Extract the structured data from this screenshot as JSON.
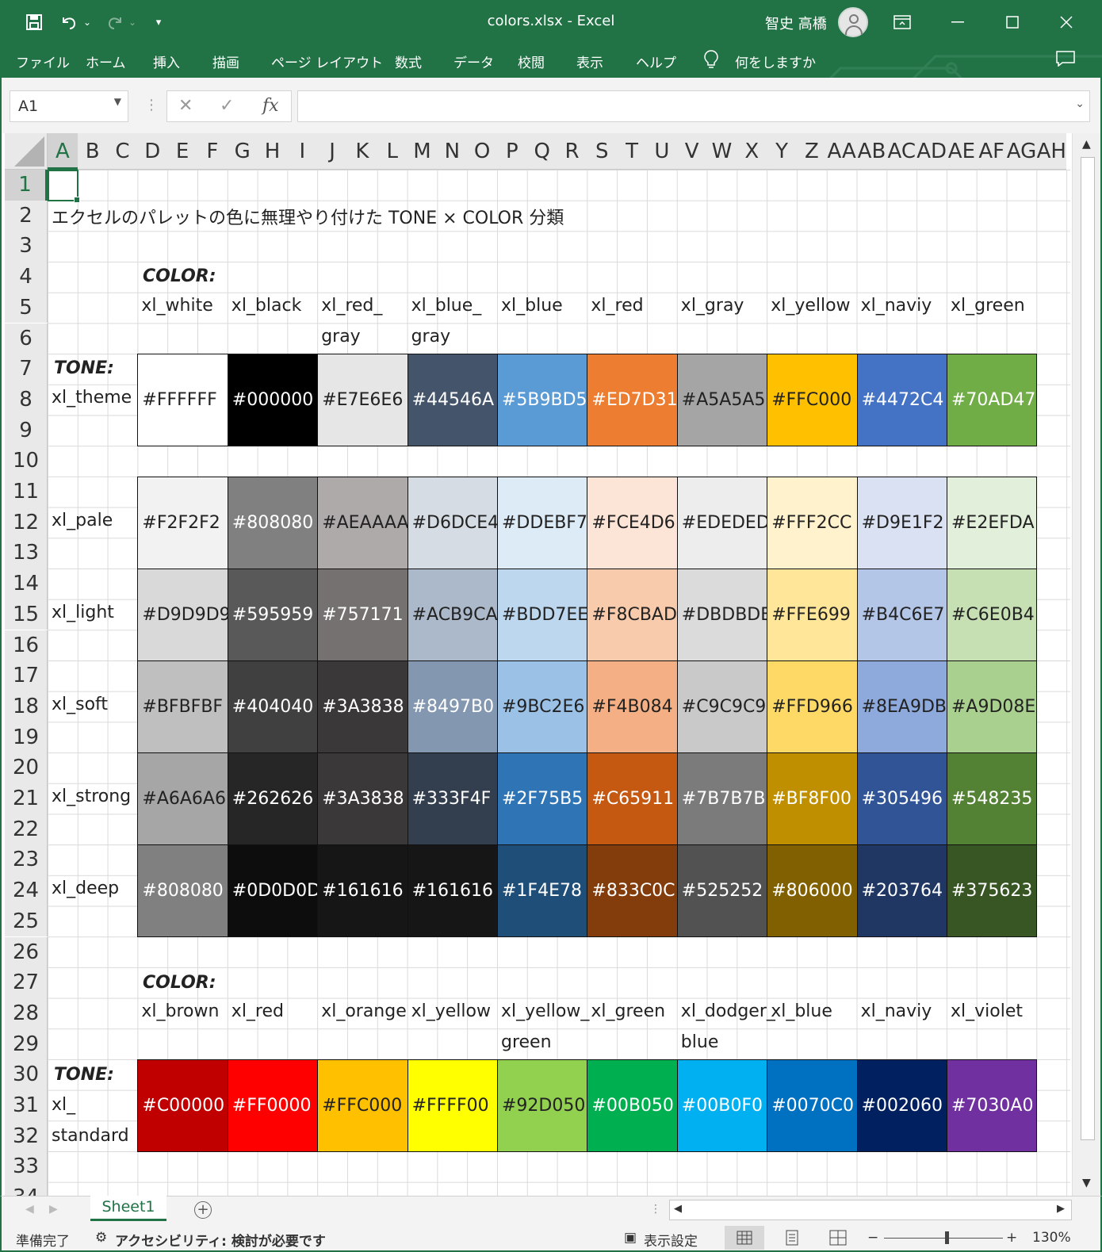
{
  "window": {
    "title": "colors.xlsx  -  Excel",
    "user": "智史 高橋",
    "save_icon": "save-icon",
    "undo_icon": "undo-icon",
    "redo_icon": "redo-icon"
  },
  "ribbon": {
    "tabs": [
      "ファイル",
      "ホーム",
      "挿入",
      "描画",
      "ページ レイアウト",
      "数式",
      "データ",
      "校閲",
      "表示",
      "ヘルプ"
    ],
    "tell_me": "何をしますか"
  },
  "formula_bar": {
    "name_box": "A1",
    "fx_label": "fx",
    "formula": ""
  },
  "columns": [
    "A",
    "B",
    "C",
    "D",
    "E",
    "F",
    "G",
    "H",
    "I",
    "J",
    "K",
    "L",
    "M",
    "N",
    "O",
    "P",
    "Q",
    "R",
    "S",
    "T",
    "U",
    "V",
    "W",
    "X",
    "Y",
    "Z",
    "AA",
    "AB",
    "AC",
    "AD",
    "AE",
    "AF",
    "AG",
    "AH"
  ],
  "rows": [
    "1",
    "2",
    "3",
    "4",
    "5",
    "6",
    "7",
    "8",
    "9",
    "10",
    "11",
    "12",
    "13",
    "14",
    "15",
    "16",
    "17",
    "18",
    "19",
    "20",
    "21",
    "22",
    "23",
    "24",
    "25",
    "26",
    "27",
    "28",
    "29",
    "30",
    "31",
    "32",
    "33",
    "34"
  ],
  "sheet": {
    "heading": "エクセルのパレットの色に無理やり付けた TONE × COLOR 分類",
    "color_label": "COLOR:",
    "tone_label": "TONE:",
    "theme_colors": [
      "xl_white",
      "xl_black",
      "xl_red_",
      "xl_blue_",
      "xl_blue",
      "xl_red",
      "xl_gray",
      "xl_yellow",
      "xl_naviy",
      "xl_green"
    ],
    "theme_colors_line2": [
      "",
      "",
      "gray",
      "gray",
      "",
      "",
      "",
      "",
      "",
      ""
    ],
    "tones": [
      {
        "name": "xl_theme",
        "values": [
          "#FFFFFF",
          "#000000",
          "#E7E6E6",
          "#44546A",
          "#5B9BD5",
          "#ED7D31",
          "#A5A5A5",
          "#FFC000",
          "#4472C4",
          "#70AD47"
        ]
      },
      {
        "name": "xl_pale",
        "values": [
          "#F2F2F2",
          "#808080",
          "#AEAAAA",
          "#D6DCE4",
          "#DDEBF7",
          "#FCE4D6",
          "#EDEDED",
          "#FFF2CC",
          "#D9E1F2",
          "#E2EFDA"
        ]
      },
      {
        "name": "xl_light",
        "values": [
          "#D9D9D9",
          "#595959",
          "#757171",
          "#ACB9CA",
          "#BDD7EE",
          "#F8CBAD",
          "#DBDBDB",
          "#FFE699",
          "#B4C6E7",
          "#C6E0B4"
        ]
      },
      {
        "name": "xl_soft",
        "values": [
          "#BFBFBF",
          "#404040",
          "#3A3838",
          "#8497B0",
          "#9BC2E6",
          "#F4B084",
          "#C9C9C9",
          "#FFD966",
          "#8EA9DB",
          "#A9D08E"
        ]
      },
      {
        "name": "xl_strong",
        "values": [
          "#A6A6A6",
          "#262626",
          "#3A3838",
          "#333F4F",
          "#2F75B5",
          "#C65911",
          "#7B7B7B",
          "#BF8F00",
          "#305496",
          "#548235"
        ]
      },
      {
        "name": "xl_deep",
        "values": [
          "#808080",
          "#0D0D0D",
          "#161616",
          "#161616",
          "#1F4E78",
          "#833C0C",
          "#525252",
          "#806000",
          "#203764",
          "#375623"
        ]
      }
    ],
    "standard_colors": [
      "xl_brown",
      "xl_red",
      "xl_orange",
      "xl_yellow",
      "xl_yellow_",
      "xl_green",
      "xl_dodger_",
      "xl_blue",
      "xl_naviy",
      "xl_violet"
    ],
    "standard_colors_line2": [
      "",
      "",
      "",
      "",
      "green",
      "",
      "blue",
      "",
      "",
      ""
    ],
    "standard_tone_line1": "xl_",
    "standard_tone_line2": "standard",
    "standard_values": [
      "#C00000",
      "#FF0000",
      "#FFC000",
      "#FFFF00",
      "#92D050",
      "#00B050",
      "#00B0F0",
      "#0070C0",
      "#002060",
      "#7030A0"
    ]
  },
  "tabs": {
    "sheet1": "Sheet1"
  },
  "status": {
    "ready": "準備完了",
    "accessibility": "アクセシビリティ: 検討が必要です",
    "display_settings": "表示設定",
    "zoom": "130%"
  },
  "colors": {
    "excel_green": "#217346"
  }
}
